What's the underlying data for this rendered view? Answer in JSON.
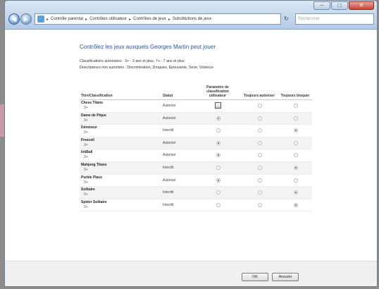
{
  "nav": {
    "breadcrumb": [
      "Contrôle parental",
      "Contrôles utilisateur",
      "Contrôles de jeux",
      "Substitutions de jeux"
    ],
    "search_placeholder": "Rechercher"
  },
  "page": {
    "heading": "Contrôlez les jeux auxquels Georges Martin peut jouer",
    "allowed": "Classifications autorisées : 3+ - 3 ans et plus, 7+ - 7 ans et plus",
    "blocked_descriptors": "Descripteurs non autorisés : Discrimination, Drogues, Épouvante, Sexe, Violence"
  },
  "table": {
    "headers": {
      "title": "Titre/Classification",
      "status": "Statut",
      "param": "Paramètre de classification utilisateur",
      "always_allow": "Toujours autoriser",
      "always_block": "Toujours bloquer"
    },
    "rows": [
      {
        "name": "Chess Titans",
        "rating": "3+",
        "status": "Autorisé",
        "choice": "param-icon"
      },
      {
        "name": "Dame de Pique",
        "rating": "3+",
        "status": "Autorisé",
        "choice": "param"
      },
      {
        "name": "Démineur",
        "rating": "3+",
        "status": "Interdit",
        "choice": "block"
      },
      {
        "name": "Freecell",
        "rating": "3+",
        "status": "Autorisé",
        "choice": "param"
      },
      {
        "name": "InkBall",
        "rating": "3+",
        "status": "Autorisé",
        "choice": "param"
      },
      {
        "name": "Mahjong Titans",
        "rating": "3+",
        "status": "Interdit",
        "choice": "block"
      },
      {
        "name": "Purble Place",
        "rating": "3+",
        "status": "Autorisé",
        "choice": "param"
      },
      {
        "name": "Solitaire",
        "rating": "3+",
        "status": "Interdit",
        "choice": "block"
      },
      {
        "name": "Spider Solitaire",
        "rating": "3+",
        "status": "Interdit",
        "choice": "block"
      }
    ]
  },
  "footer": {
    "ok": "OK",
    "cancel": "Annuler"
  }
}
